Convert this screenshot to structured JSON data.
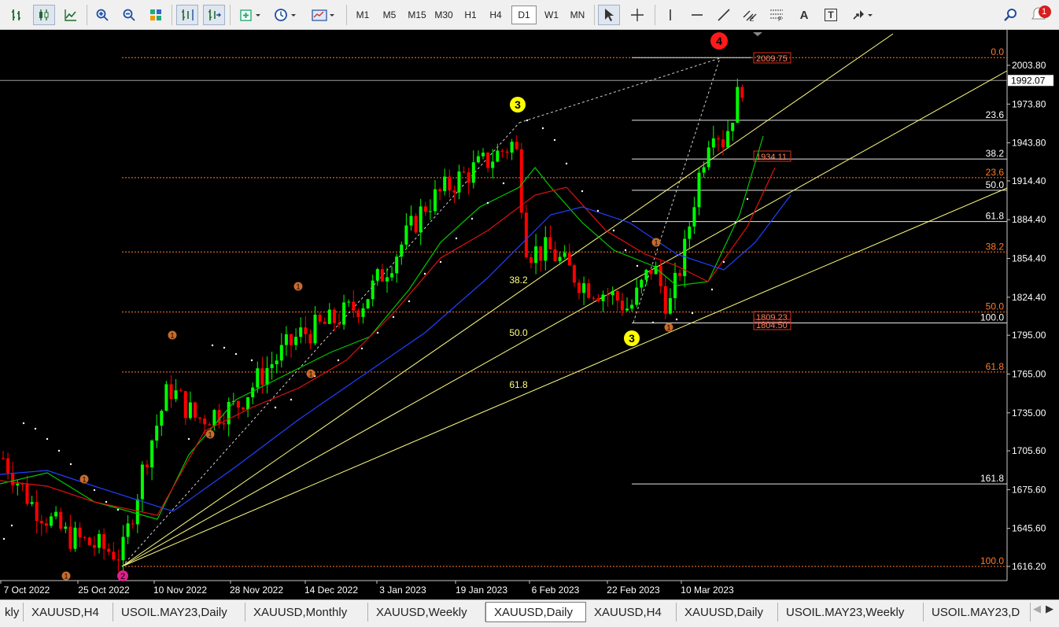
{
  "toolbar": {
    "timeframes": [
      "M1",
      "M5",
      "M15",
      "M30",
      "H1",
      "H4",
      "D1",
      "W1",
      "MN"
    ],
    "active_timeframe": "D1",
    "notification_count": "1",
    "text_tool_label": "A",
    "text_label_tool_label": "T"
  },
  "chart": {
    "symbol": "XAUUSD",
    "timeframe": "D1",
    "current_price": "1992.07",
    "price_ticks": [
      "2003.80",
      "1973.80",
      "1943.80",
      "1914.40",
      "1884.40",
      "1854.40",
      "1824.40",
      "1795.00",
      "1765.00",
      "1735.00",
      "1705.60",
      "1675.60",
      "1645.60",
      "1616.20"
    ],
    "date_ticks": [
      "7 Oct 2022",
      "25 Oct 2022",
      "10 Nov 2022",
      "28 Nov 2022",
      "14 Dec 2022",
      "3 Jan 2023",
      "19 Jan 2023",
      "6 Feb 2023",
      "22 Feb 2023",
      "10 Mar 2023"
    ],
    "fib_big_levels": [
      "0.0",
      "23.6",
      "38.2",
      "50.0",
      "61.8",
      "100.0"
    ],
    "fib_small_levels": [
      "0.0",
      "23.6",
      "38.2",
      "50.0",
      "61.8",
      "100.0",
      "161.8"
    ],
    "fan_labels": [
      "38.2",
      "50.0",
      "61.8"
    ],
    "price_labels": [
      "2009.75",
      "1934.11",
      "1809.23",
      "1804.50"
    ],
    "wave_labels": {
      "major_3": "3",
      "major_4": "4",
      "minor_3": "3",
      "minor_2": "2",
      "minor_1": "1"
    },
    "colors": {
      "bull": "#00ff00",
      "bear": "#ff0000",
      "ma_fast": "#00c800",
      "ma_mid": "#e01010",
      "ma_slow": "#2040ff",
      "fib": "#ff7a2a",
      "fan": "#ffff80",
      "wave_major": "#ffff00",
      "wave_top": "#ff1a1a"
    }
  },
  "tabs": {
    "items": [
      "kly",
      "XAUUSD,H4",
      "USOIL.MAY23,Daily",
      "XAUUSD,Monthly",
      "XAUUSD,Weekly",
      "XAUUSD,Daily",
      "XAUUSD,H4",
      "XAUUSD,Daily",
      "USOIL.MAY23,Weekly",
      "USOIL.MAY23,D"
    ],
    "active_index": 5
  }
}
